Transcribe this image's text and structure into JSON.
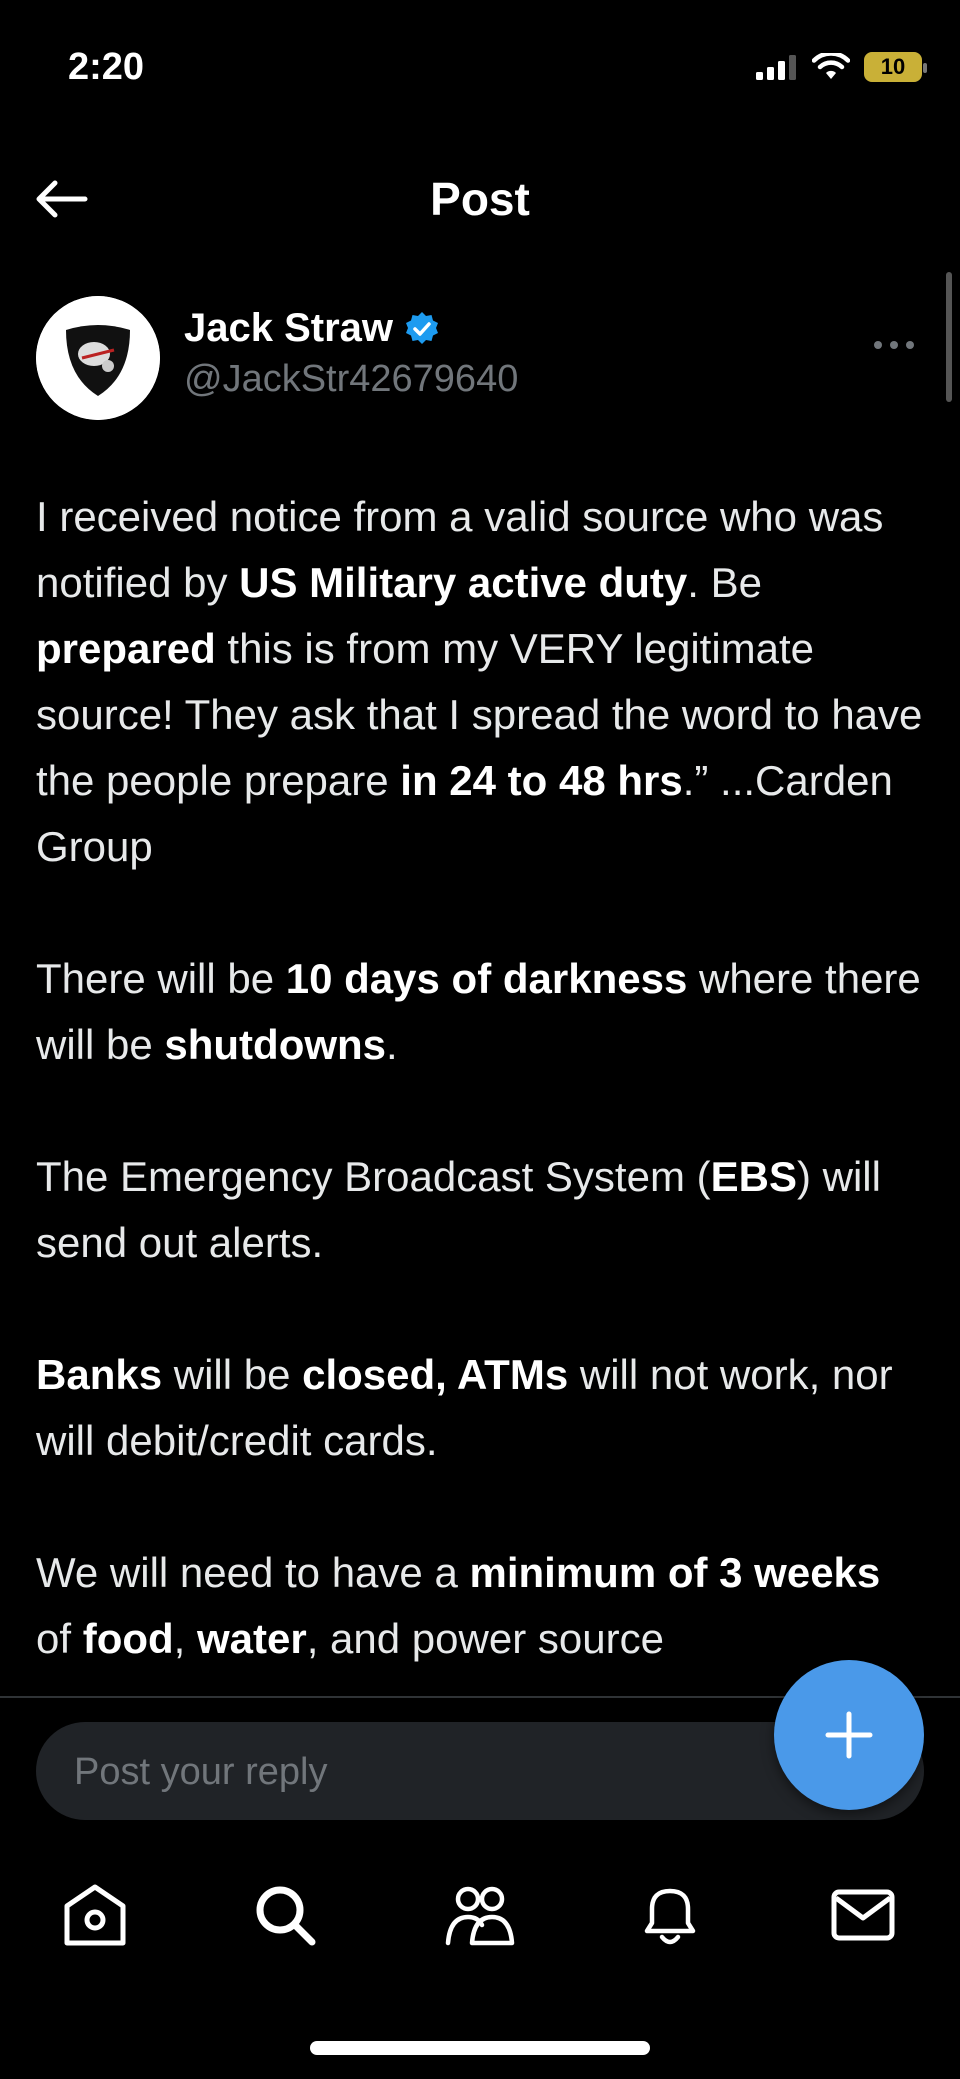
{
  "status": {
    "time": "2:20",
    "battery": "10"
  },
  "header": {
    "title": "Post"
  },
  "author": {
    "name": "Jack Straw",
    "handle": "@JackStr42679640"
  },
  "post": {
    "p1": [
      {
        "t": "I received notice from a valid source who was notified by ",
        "b": false
      },
      {
        "t": "US Military active duty",
        "b": true
      },
      {
        "t": ". Be ",
        "b": false
      },
      {
        "t": "prepared",
        "b": true
      },
      {
        "t": " this is from my VERY legitimate source!   They ask that I spread the word to have the people prepare ",
        "b": false
      },
      {
        "t": "in 24 to 48 hrs",
        "b": true
      },
      {
        "t": ".” ...Carden Group",
        "b": false
      }
    ],
    "p2": [
      {
        "t": "There will be ",
        "b": false
      },
      {
        "t": "10 days of darkness",
        "b": true
      },
      {
        "t": " where there will be ",
        "b": false
      },
      {
        "t": "shutdowns",
        "b": true
      },
      {
        "t": ".",
        "b": false
      }
    ],
    "p3": [
      {
        "t": "The Emergency Broadcast System (",
        "b": false
      },
      {
        "t": "EBS",
        "b": true
      },
      {
        "t": ") will send out alerts.",
        "b": false
      }
    ],
    "p4": [
      {
        "t": "Banks",
        "b": true
      },
      {
        "t": " will be ",
        "b": false
      },
      {
        "t": "closed, ATMs",
        "b": true
      },
      {
        "t": " will not work, nor will debit/credit cards.",
        "b": false
      }
    ],
    "p5": [
      {
        "t": "We will need to have a ",
        "b": false
      },
      {
        "t": "minimum of 3 weeks",
        "b": true
      },
      {
        "t": " of ",
        "b": false
      },
      {
        "t": "food",
        "b": true
      },
      {
        "t": ", ",
        "b": false
      },
      {
        "t": "water",
        "b": true
      },
      {
        "t": ", and power source",
        "b": false
      }
    ]
  },
  "reply": {
    "placeholder": "Post your reply"
  },
  "tabs": [
    {
      "icon": "home-icon"
    },
    {
      "icon": "search-icon"
    },
    {
      "icon": "communities-icon"
    },
    {
      "icon": "notifications-icon"
    },
    {
      "icon": "messages-icon"
    }
  ],
  "colors": {
    "accent": "#4a99e9",
    "verified": "#1d9bf0",
    "muted": "#71767b",
    "background": "#000000"
  }
}
